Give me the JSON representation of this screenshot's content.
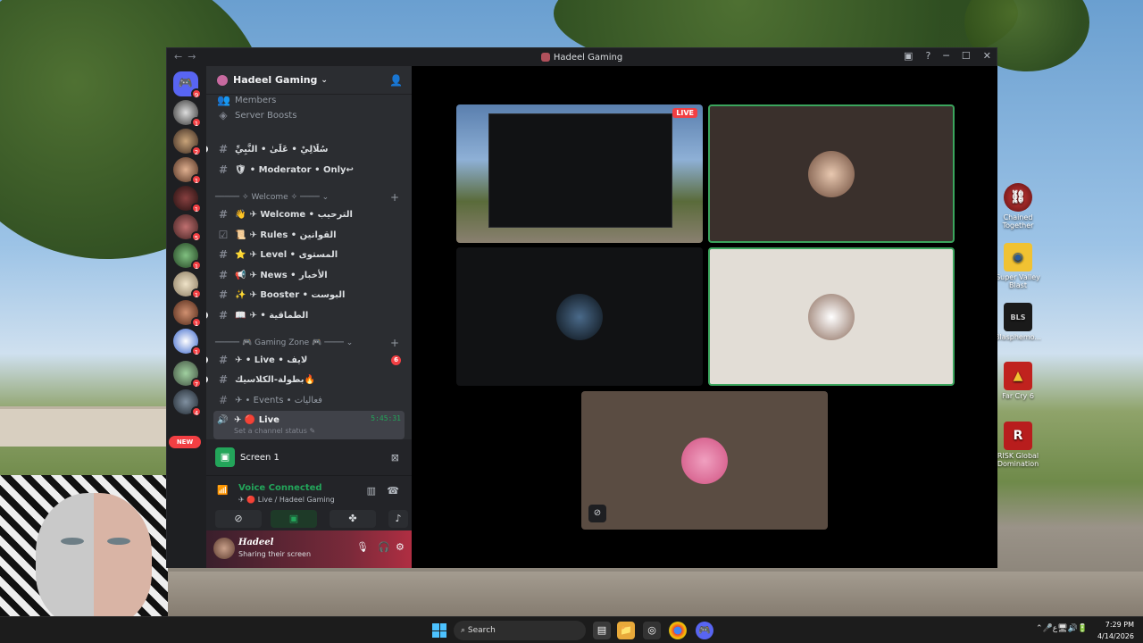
{
  "window": {
    "title": "Hadeel Gaming"
  },
  "guilds": [
    {
      "badge": "9"
    },
    {
      "badge": "1"
    },
    {
      "badge": "2"
    },
    {
      "badge": "1"
    },
    {
      "badge": "1"
    },
    {
      "badge": "5"
    },
    {
      "badge": "1"
    },
    {
      "badge": "1"
    },
    {
      "badge": "1"
    },
    {
      "badge": "1"
    },
    {
      "badge": "7"
    },
    {
      "badge": "4"
    }
  ],
  "new_label": "NEW",
  "server": {
    "name": "Hadeel Gaming"
  },
  "channels": {
    "members": "Members",
    "server_boosts": "Server Boosts",
    "pinned": [
      {
        "label": "سُلَالِيْ • عَلَىٰ • النَّبِيِّ"
      },
      {
        "label": "• Moderator • Only↩",
        "emoji": "🛡"
      }
    ],
    "cat_welcome": "Welcome",
    "welcome": [
      {
        "emoji": "👋",
        "label": "✈ Welcome • الترحيب"
      },
      {
        "emoji": "📜",
        "label": "✈ Rules • القوانين"
      },
      {
        "emoji": "⭐",
        "label": "✈ Level • المستوى"
      },
      {
        "emoji": "📢",
        "label": "✈ News • الأخبار"
      },
      {
        "emoji": "✨",
        "label": "✈ Booster • البوست"
      },
      {
        "emoji": "📖",
        "label": "✈ • الطماقية"
      }
    ],
    "cat_gaming": "Gaming Zone",
    "gaming": [
      {
        "label": "✈ • Live • لايف",
        "mentions": "6"
      },
      {
        "label": "بطولة-الكلاسيك🔥"
      },
      {
        "label": "✈ • Events • فعاليات"
      }
    ],
    "voice": {
      "label": "✈ 🔴 Live",
      "timer": "5:45:31",
      "status": "Set a channel status"
    }
  },
  "screen_panel": {
    "label": "Screen 1"
  },
  "voice_panel": {
    "status": "Voice Connected",
    "location": "✈ 🔴 Live / Hadeel Gaming"
  },
  "user": {
    "name": "Hadeel",
    "status": "Sharing their screen"
  },
  "stage": {
    "live_badge": "LIVE"
  },
  "desktop_icons": [
    {
      "label": "Chained Together"
    },
    {
      "label": "Super Valley Blast"
    },
    {
      "label": "Blasphemo..."
    },
    {
      "label": "Far Cry 6"
    },
    {
      "label": "RISK Global Domination"
    }
  ],
  "taskbar": {
    "search": "Search",
    "time": "7:29 PM",
    "date": "4/14/2026",
    "lang": "ع"
  },
  "colors": {
    "accent": "#5865f2",
    "online": "#23a55a",
    "danger": "#f23f43"
  }
}
